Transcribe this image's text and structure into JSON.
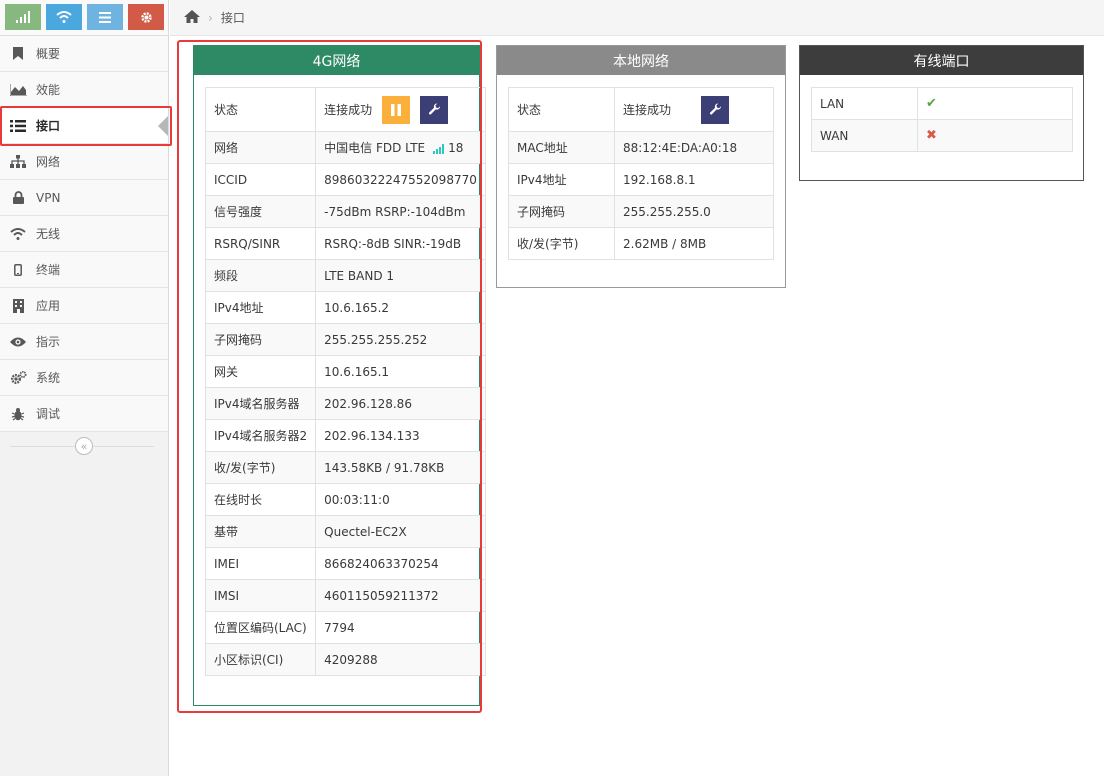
{
  "sidebar": {
    "shortcuts": [
      {
        "icon": "signal-icon",
        "color": "#87b87f"
      },
      {
        "icon": "wifi-icon",
        "color": "#4ba8de"
      },
      {
        "icon": "list-icon",
        "color": "#6fb3e0"
      },
      {
        "icon": "gear-icon",
        "color": "#d15b47"
      }
    ],
    "items": [
      {
        "label": "概要",
        "icon": "bookmark-icon"
      },
      {
        "label": "效能",
        "icon": "area-chart-icon"
      },
      {
        "label": "接口",
        "icon": "list-icon",
        "active": true
      },
      {
        "label": "网络",
        "icon": "sitemap-icon"
      },
      {
        "label": "VPN",
        "icon": "lock-icon"
      },
      {
        "label": "无线",
        "icon": "wifi-icon"
      },
      {
        "label": "终端",
        "icon": "mobile-icon"
      },
      {
        "label": "应用",
        "icon": "building-icon"
      },
      {
        "label": "指示",
        "icon": "eye-icon"
      },
      {
        "label": "系统",
        "icon": "cogs-icon"
      },
      {
        "label": "调试",
        "icon": "bug-icon"
      }
    ],
    "collapse_icon": "«"
  },
  "breadcrumb": {
    "home_icon": "home-icon",
    "separator": "›",
    "current": "接口"
  },
  "panel_4g": {
    "title": "4G网络",
    "header_color": "#2e8965",
    "status_label": "状态",
    "status_value": "连接成功",
    "network_label": "网络",
    "network_value": "中国电信  FDD LTE",
    "signal_value": "18",
    "rows": [
      {
        "k": "ICCID",
        "v": "89860322247552098770"
      },
      {
        "k": "信号强度",
        "v": "-75dBm  RSRP:-104dBm"
      },
      {
        "k": "RSRQ/SINR",
        "v": "RSRQ:-8dB  SINR:-19dB"
      },
      {
        "k": "频段",
        "v": "LTE BAND 1"
      },
      {
        "k": "IPv4地址",
        "v": "10.6.165.2"
      },
      {
        "k": "子网掩码",
        "v": "255.255.255.252"
      },
      {
        "k": "网关",
        "v": "10.6.165.1"
      },
      {
        "k": "IPv4域名服务器",
        "v": "202.96.128.86"
      },
      {
        "k": "IPv4域名服务器2",
        "v": "202.96.134.133"
      },
      {
        "k": "收/发(字节)",
        "v": "143.58KB / 91.78KB"
      },
      {
        "k": "在线时长",
        "v": "00:03:11:0"
      },
      {
        "k": "基带",
        "v": "Quectel-EC2X"
      },
      {
        "k": "IMEI",
        "v": "866824063370254"
      },
      {
        "k": "IMSI",
        "v": "460115059211372"
      },
      {
        "k": "位置区编码(LAC)",
        "v": "7794"
      },
      {
        "k": "小区标识(CI)",
        "v": "4209288"
      }
    ]
  },
  "panel_local": {
    "title": "本地网络",
    "header_color": "#8a8a8a",
    "status_label": "状态",
    "status_value": "连接成功",
    "rows": [
      {
        "k": "MAC地址",
        "v": "88:12:4E:DA:A0:18"
      },
      {
        "k": "IPv4地址",
        "v": "192.168.8.1"
      },
      {
        "k": "子网掩码",
        "v": "255.255.255.0"
      },
      {
        "k": "收/发(字节)",
        "v": "2.62MB / 8MB"
      }
    ]
  },
  "panel_wired": {
    "title": "有线端口",
    "header_color": "#3d3d3d",
    "rows": [
      {
        "k": "LAN",
        "status": "up",
        "mark": "✔"
      },
      {
        "k": "WAN",
        "status": "down",
        "mark": "✖"
      }
    ]
  },
  "colors": {
    "highlight": "#e83a3a",
    "pause_button": "#fbb03b",
    "wrench_button": "#3c3f75",
    "signal": "#2bc7c0"
  }
}
